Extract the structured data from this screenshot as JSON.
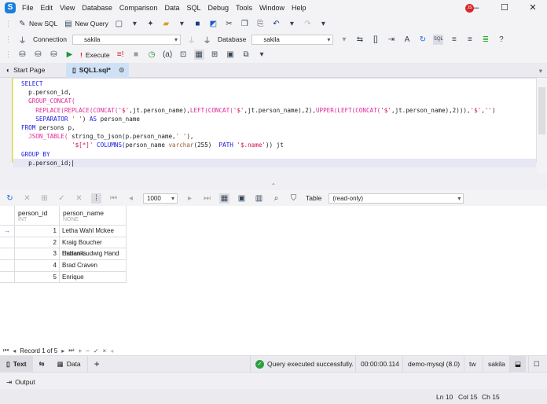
{
  "app": {
    "logo": "S",
    "menu": [
      "File",
      "Edit",
      "View",
      "Database",
      "Comparison",
      "Data",
      "SQL",
      "Debug",
      "Tools",
      "Window",
      "Help"
    ],
    "user_badge": "JS"
  },
  "toolbar1": {
    "new_sql": "New SQL",
    "new_query": "New Query"
  },
  "toolbar2": {
    "connection_label": "Connection",
    "connection_value": "sakila",
    "database_label": "Database",
    "database_value": "sakila"
  },
  "toolbar3": {
    "execute": "Execute"
  },
  "tabs": [
    {
      "label": "Start Page"
    },
    {
      "label": "SQL1.sql*"
    }
  ],
  "editor": {
    "lines": [
      [
        [
          "SELECT",
          "k"
        ]
      ],
      [
        [
          "  p.person_id,",
          "n"
        ]
      ],
      [
        [
          "  ",
          "n"
        ],
        [
          "GROUP_CONCAT(",
          "f"
        ]
      ],
      [
        [
          "    ",
          "n"
        ],
        [
          "REPLACE(REPLACE(CONCAT(",
          "f"
        ],
        [
          "'$'",
          "s"
        ],
        [
          ",jt.person_name),",
          "n"
        ],
        [
          "LEFT(CONCAT(",
          "f"
        ],
        [
          "'$'",
          "s"
        ],
        [
          ",jt.person_name),2),",
          "n"
        ],
        [
          "UPPER(LEFT(CONCAT(",
          "f"
        ],
        [
          "'$'",
          "s"
        ],
        [
          ",jt.person_name),2))),",
          "n"
        ],
        [
          "'$'",
          "s"
        ],
        [
          ",",
          "n"
        ],
        [
          "''",
          "s"
        ],
        [
          ")",
          "n"
        ]
      ],
      [
        [
          "    ",
          "n"
        ],
        [
          "SEPARATOR",
          "k"
        ],
        [
          " ",
          "n"
        ],
        [
          "' '",
          "s"
        ],
        [
          ") ",
          "n"
        ],
        [
          "AS",
          "k"
        ],
        [
          " person_name",
          "n"
        ]
      ],
      [
        [
          "FROM",
          "k"
        ],
        [
          " persons p,",
          "n"
        ]
      ],
      [
        [
          "  ",
          "n"
        ],
        [
          "JSON_TABLE(",
          "f"
        ],
        [
          " string_to_json(p.person_name,",
          "n"
        ],
        [
          "' '",
          "s"
        ],
        [
          "),",
          "n"
        ]
      ],
      [
        [
          "              ",
          "n"
        ],
        [
          "'$[*]'",
          "s"
        ],
        [
          " ",
          "n"
        ],
        [
          "COLUMNS(",
          "k"
        ],
        [
          "person_name ",
          "n"
        ],
        [
          "varchar",
          "t"
        ],
        [
          "(255)  ",
          "n"
        ],
        [
          "PATH",
          "k"
        ],
        [
          " ",
          "n"
        ],
        [
          "'$.name'",
          "s"
        ],
        [
          ")) jt",
          "n"
        ]
      ],
      [
        [
          "GROUP BY",
          "k"
        ]
      ],
      [
        [
          "  p.person_id;",
          "n"
        ]
      ]
    ]
  },
  "grid_toolbar": {
    "page_size": "1000",
    "table_label": "Table",
    "table_value": "(read-only)"
  },
  "grid": {
    "columns": [
      {
        "name": "person_id",
        "type": "INT"
      },
      {
        "name": "person_name",
        "type": "NONE"
      }
    ],
    "rows": [
      [
        "1",
        "Letha Wahl Mckee"
      ],
      [
        "2",
        "Kraig Boucher Eubanks"
      ],
      [
        "3",
        "Harlan Ludwig Hand"
      ],
      [
        "4",
        "Brad Craven"
      ],
      [
        "5",
        "Enrique"
      ]
    ]
  },
  "record_nav": {
    "label": "Record 1 of 5"
  },
  "bottom_tabs": {
    "text": "Text",
    "data": "Data"
  },
  "status": {
    "message": "Query executed successfully.",
    "elapsed": "00:00:00.114",
    "connection": "demo-mysql (8.0)",
    "user": "tw",
    "database": "sakila"
  },
  "output": {
    "label": "Output"
  },
  "statusline": {
    "ln": "Ln 10",
    "col": "Col 15",
    "ch": "Ch 15"
  },
  "colors": {
    "accent": "#1a7ee0",
    "active_tab": "#cfe1f6",
    "success": "#2ea043",
    "gutter": "#f0e000"
  }
}
